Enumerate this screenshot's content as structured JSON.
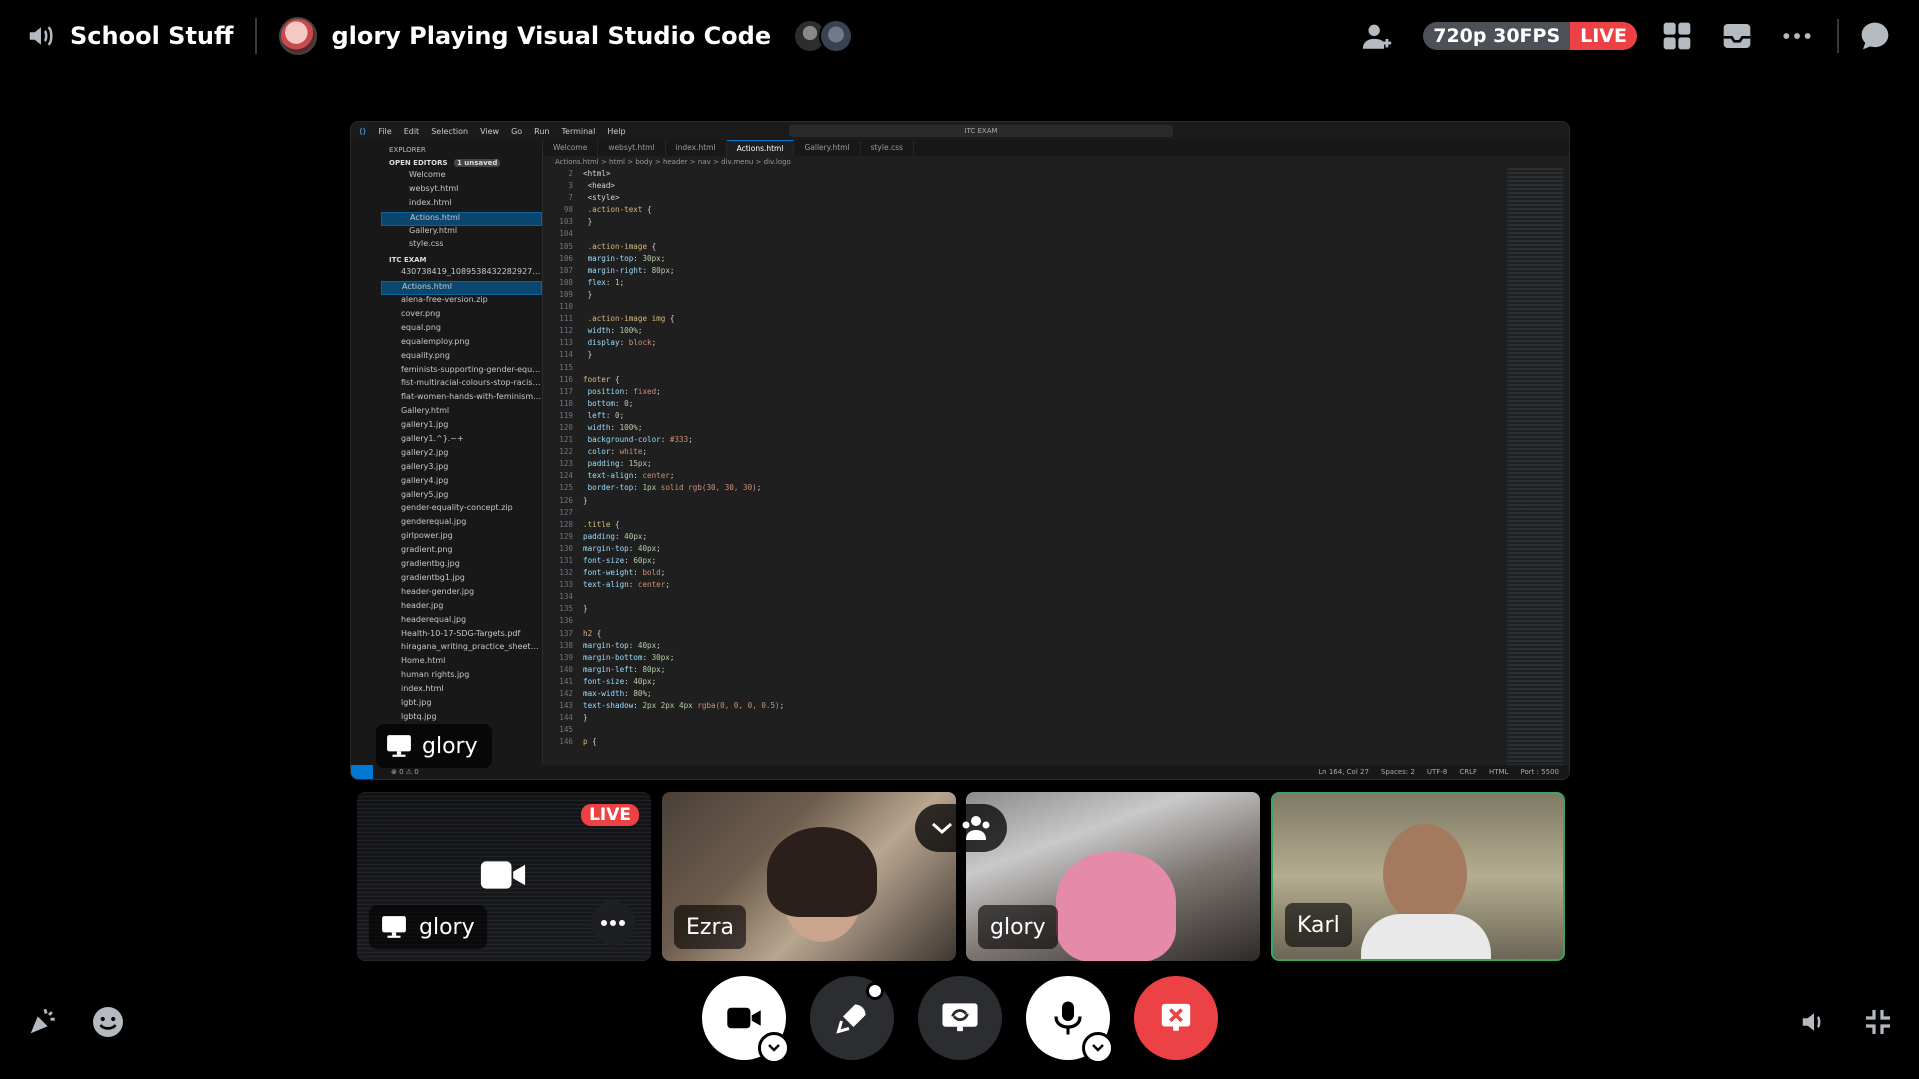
{
  "header": {
    "channel_name": "School Stuff",
    "activity_text": "glory Playing Visual Studio Code",
    "quality_badge": "720p 30FPS",
    "live_badge": "LIVE"
  },
  "stream": {
    "streamer_name": "glory",
    "vscode": {
      "menu": [
        "File",
        "Edit",
        "Selection",
        "View",
        "Go",
        "Run",
        "Terminal",
        "Help"
      ],
      "search": "ITC EXAM",
      "tabs": [
        "Welcome",
        "websyt.html",
        "index.html",
        "Actions.html",
        "Gallery.html",
        "style.css"
      ],
      "active_tab": "Actions.html",
      "breadcrumb": "Actions.html > html > body > header > nav > div.menu > div.logo",
      "explorer_title": "EXPLORER",
      "open_editors_label": "OPEN EDITORS",
      "unsaved": "1 unsaved",
      "open_editors": [
        "Welcome",
        "websyt.html",
        "index.html",
        "Actions.html",
        "Gallery.html",
        "style.css"
      ],
      "folder_label": "ITC EXAM",
      "files": [
        "430738419_1089538432282927_777...",
        "Actions.html",
        "alena-free-version.zip",
        "cover.png",
        "equal.png",
        "equalemploy.png",
        "equality.png",
        "feminists-supporting-gender-equalit...",
        "fist-multiracial-colours-stop-racism-...",
        "flat-women-hands-with-feminism-fis...",
        "Gallery.html",
        "gallery1.jpg",
        "gallery1.^}.~+",
        "gallery2.jpg",
        "gallery3.jpg",
        "gallery4.jpg",
        "gallery5.jpg",
        "gender-equality-concept.zip",
        "genderequal.jpg",
        "girlpower.jpg",
        "gradient.png",
        "gradientbg.jpg",
        "gradientbg1.jpg",
        "header-gender.jpg",
        "header.jpg",
        "headerequal.jpg",
        "Health-10-17-SDG-Targets.pdf",
        "hiragana_writing_practice_sheets.pdf",
        "Home.html",
        "human rights.jpg",
        "index.html",
        "lgbt.jpg",
        "lgbtq.jpg"
      ],
      "status": {
        "errors": "⊗ 0 ⚠ 0",
        "ports": "⚡0",
        "position": "Ln 164, Col 27",
        "spaces": "Spaces: 2",
        "encoding": "UTF-8",
        "eol": "CRLF",
        "language": "HTML",
        "port": "Port : 5500"
      }
    }
  },
  "participants": [
    {
      "name": "glory",
      "live": "LIVE"
    },
    {
      "name": "Ezra"
    },
    {
      "name": "glory"
    },
    {
      "name": "Karl"
    }
  ],
  "colors": {
    "live_red": "#ed4245",
    "speaking_green": "#3ba55d",
    "control_dark": "#2b2d31"
  }
}
